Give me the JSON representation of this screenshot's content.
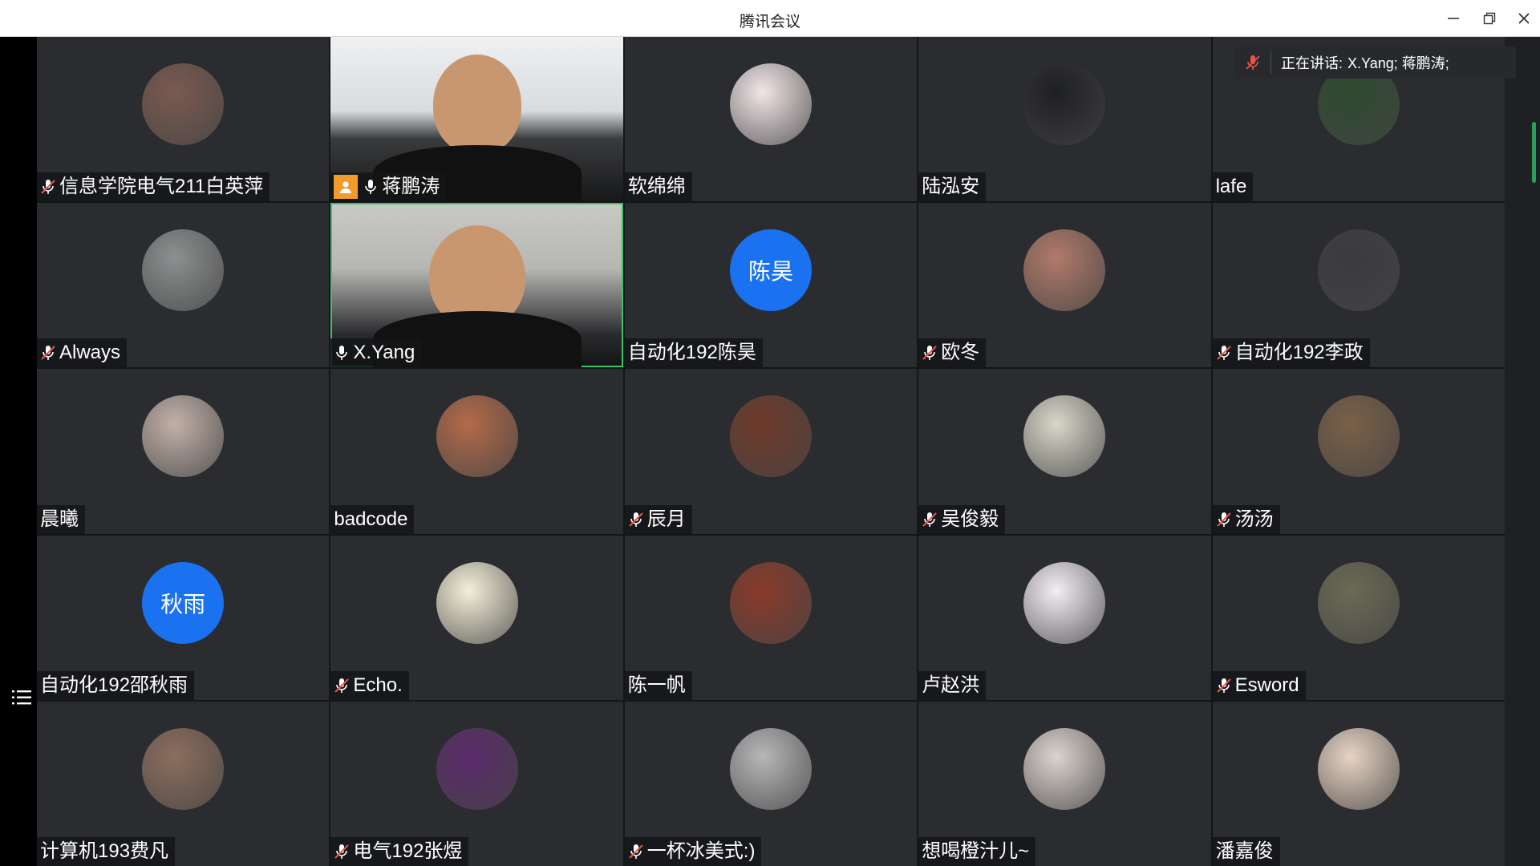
{
  "window": {
    "title": "腾讯会议"
  },
  "speaking_bar": {
    "prefix": "正在讲话:",
    "names": "X.Yang; 蒋鹏涛;"
  },
  "colors": {
    "tile_bg": "#2a2c30",
    "avatar_blue": "#1a72f0",
    "active_border": "#3ec36b",
    "host_badge": "#f29b2d"
  },
  "participants": [
    {
      "name": "信息学院电气211白英萍",
      "mic": "muted",
      "kind": "avatar"
    },
    {
      "name": "蒋鹏涛",
      "mic": "on",
      "kind": "video",
      "host": true
    },
    {
      "name": "软绵绵",
      "mic": "none",
      "kind": "avatar"
    },
    {
      "name": "陆泓安",
      "mic": "none",
      "kind": "avatar"
    },
    {
      "name": "lafe",
      "mic": "none",
      "kind": "avatar"
    },
    {
      "name": "Always",
      "mic": "muted",
      "kind": "avatar"
    },
    {
      "name": "X.Yang",
      "mic": "on",
      "kind": "video",
      "speaking": true
    },
    {
      "name": "自动化192陈昊",
      "mic": "none",
      "kind": "initials",
      "initials": "陈昊"
    },
    {
      "name": "欧冬",
      "mic": "muted",
      "kind": "avatar"
    },
    {
      "name": "自动化192李政",
      "mic": "muted",
      "kind": "avatar"
    },
    {
      "name": "晨曦",
      "mic": "none",
      "kind": "avatar"
    },
    {
      "name": "badcode",
      "mic": "none",
      "kind": "avatar"
    },
    {
      "name": "辰月",
      "mic": "muted",
      "kind": "avatar"
    },
    {
      "name": "吴俊毅",
      "mic": "muted",
      "kind": "avatar"
    },
    {
      "name": "汤汤",
      "mic": "muted",
      "kind": "avatar"
    },
    {
      "name": "自动化192邵秋雨",
      "mic": "none",
      "kind": "initials",
      "initials": "秋雨"
    },
    {
      "name": "Echo.",
      "mic": "muted",
      "kind": "avatar"
    },
    {
      "name": "陈一帆",
      "mic": "none",
      "kind": "avatar"
    },
    {
      "name": "卢赵洪",
      "mic": "none",
      "kind": "avatar"
    },
    {
      "name": "Esword",
      "mic": "muted",
      "kind": "avatar"
    },
    {
      "name": "计算机193费凡",
      "mic": "none",
      "kind": "avatar"
    },
    {
      "name": "电气192张煜",
      "mic": "muted",
      "kind": "avatar"
    },
    {
      "name": "一杯冰美式:)",
      "mic": "muted",
      "kind": "avatar"
    },
    {
      "name": "想喝橙汁儿~",
      "mic": "none",
      "kind": "avatar"
    },
    {
      "name": "潘嘉俊",
      "mic": "none",
      "kind": "avatar"
    }
  ]
}
